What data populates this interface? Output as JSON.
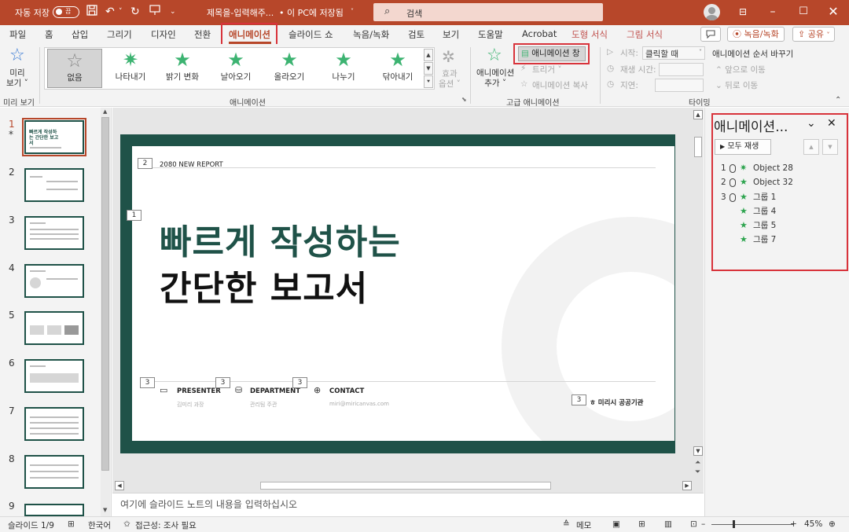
{
  "titlebar": {
    "autosave_label": "자동 저장",
    "autosave_state": "끔",
    "document_title": "제목을-입력해주...",
    "save_location": "• 이 PC에 저장됨",
    "search_placeholder": "검색",
    "save_icon": "save-icon",
    "undo_icon": "undo-icon",
    "redo_icon": "redo-icon",
    "present_icon": "present-icon",
    "more_icon": "chevron-down-icon"
  },
  "tabs": [
    "파일",
    "홈",
    "삽입",
    "그리기",
    "디자인",
    "전환",
    "애니메이션",
    "슬라이드 쇼",
    "녹음/녹화",
    "검토",
    "보기",
    "도움말",
    "Acrobat",
    "도형 서식",
    "그림 서식"
  ],
  "active_tab": "애니메이션",
  "top_buttons": {
    "comment_icon": "comment-icon",
    "record": "녹음/녹화",
    "share": "공유"
  },
  "ribbon": {
    "preview_label": "미리\n보기 ˅",
    "preview_group": "미리 보기",
    "gallery": [
      {
        "label": "없음",
        "selected": true
      },
      {
        "label": "나타내기",
        "selected": false
      },
      {
        "label": "밝기 변화",
        "selected": false
      },
      {
        "label": "날아오기",
        "selected": false
      },
      {
        "label": "올라오기",
        "selected": false
      },
      {
        "label": "나누기",
        "selected": false
      },
      {
        "label": "닦아내기",
        "selected": false
      }
    ],
    "effect_options": "효과\n옵션 ˅",
    "animation_group": "애니메이션",
    "add_animation": "애니메이션\n추가 ˅",
    "animation_pane_button": "애니메이션 창",
    "trigger": "트리거 ˅",
    "animation_painter": "애니메이션 복사",
    "advanced_group": "고급 애니메이션",
    "start_label": "시작:",
    "start_value": "클릭할 때",
    "duration_label": "재생 시간:",
    "delay_label": "지연:",
    "reorder_label": "애니메이션 순서 바꾸기",
    "move_earlier": "앞으로 이동",
    "move_later": "뒤로 이동",
    "timing_group": "타이밍"
  },
  "thumbnails": {
    "numbers": [
      "1",
      "2",
      "3",
      "4",
      "5",
      "6",
      "7",
      "8",
      "9"
    ],
    "first_star": "*",
    "thumb1_title": "빠르게 작성하는 간단한 보고서"
  },
  "slide": {
    "report_label": "2080 NEW REPORT",
    "title_line1": "빠르게 작성하는",
    "title_line2": "간단한 보고서",
    "presenter": "PRESENTER",
    "presenter_sub": "김미리 과장",
    "department": "DEPARTMENT",
    "department_sub": "관리팀 주관",
    "contact": "CONTACT",
    "contact_sub": "miri@miricanvas.com",
    "org": "ㅎ 미리시 공공기관",
    "tags": {
      "t_report": "2",
      "t_title": "1",
      "t_presenter": "3",
      "t_dept": "3",
      "t_dept2": "3",
      "t_org": "3"
    }
  },
  "notes_placeholder": "여기에 슬라이드 노트의 내용을 입력하십시오",
  "animation_pane": {
    "title": "애니메이션...",
    "play_all": "모두 재생",
    "items": [
      {
        "num": "1",
        "mouse": true,
        "name": "Object 28"
      },
      {
        "num": "2",
        "mouse": true,
        "name": "Object 32"
      },
      {
        "num": "3",
        "mouse": true,
        "name": "그룹 1"
      },
      {
        "num": "",
        "mouse": false,
        "name": "그룹 4"
      },
      {
        "num": "",
        "mouse": false,
        "name": "그룹 5"
      },
      {
        "num": "",
        "mouse": false,
        "name": "그룹 7"
      }
    ]
  },
  "statusbar": {
    "slide_info": "슬라이드 1/9",
    "language": "한국어",
    "accessibility": "접근성: 조사 필요",
    "notes": "메모",
    "zoom": "45%"
  },
  "colors": {
    "accent": "#b7472a",
    "slide_green": "#1f5248",
    "highlight": "#d8333b"
  }
}
